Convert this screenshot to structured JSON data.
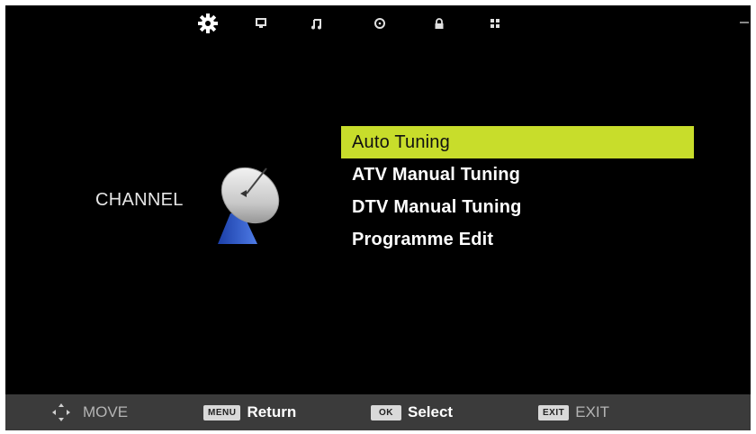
{
  "top_tabs": [
    {
      "icon": "gear-icon",
      "active": true
    },
    {
      "icon": "monitor-icon",
      "active": false
    },
    {
      "icon": "music-note-icon",
      "active": false
    },
    {
      "icon": "clock-icon",
      "active": false
    },
    {
      "icon": "lock-icon",
      "active": false
    },
    {
      "icon": "grid-icon",
      "active": false
    }
  ],
  "section": {
    "label": "CHANNEL",
    "icon": "satellite-dish-icon"
  },
  "menu": {
    "items": [
      {
        "label": "Auto Tuning",
        "selected": true
      },
      {
        "label": "ATV Manual Tuning",
        "selected": false
      },
      {
        "label": "DTV Manual Tuning",
        "selected": false
      },
      {
        "label": "Programme Edit",
        "selected": false
      }
    ]
  },
  "footer": {
    "move": {
      "icon": "direction-pad-icon",
      "label": "MOVE"
    },
    "return": {
      "key": "MENU",
      "label": "Return"
    },
    "select": {
      "key": "OK",
      "label": "Select"
    },
    "exit": {
      "key": "EXIT",
      "label": "EXIT"
    }
  },
  "colors": {
    "highlight": "#c8dd2b",
    "background": "#000000",
    "footer": "#3b3b3b"
  }
}
